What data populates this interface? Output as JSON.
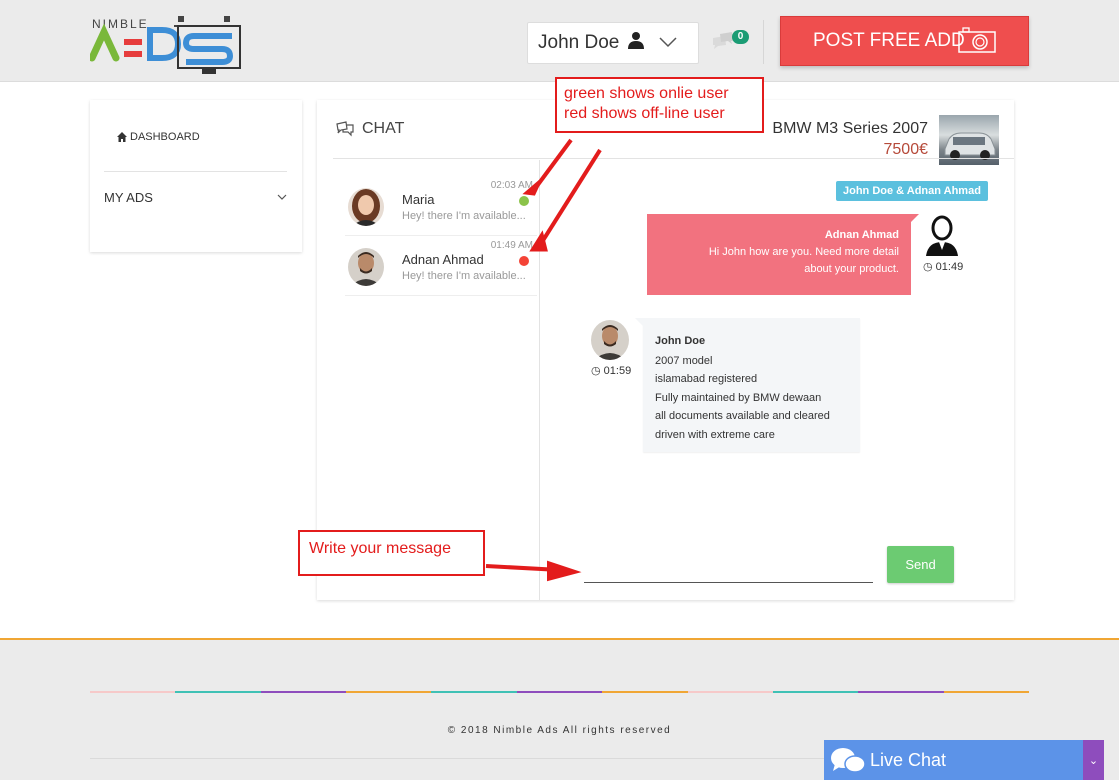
{
  "header": {
    "logo_top": "NIMBLE",
    "logo_main": "ADS",
    "user_name": "John Doe",
    "message_count": "0",
    "post_button_label": "POST FREE ADD"
  },
  "sidebar": {
    "dashboard_label": "DASHBOARD",
    "my_ads_label": "MY ADS"
  },
  "chat": {
    "title": "CHAT",
    "car_title": "BMW M3 Series 2007",
    "car_price": "7500€",
    "contacts": [
      {
        "name": "Maria",
        "preview": "Hey! there I'm available...",
        "time": "02:03 AM",
        "status": "online",
        "status_color": "#8bc34a"
      },
      {
        "name": "Adnan Ahmad",
        "preview": "Hey! there I'm available...",
        "time": "01:49 AM",
        "status": "offline",
        "status_color": "#f44336"
      }
    ],
    "conversation_badge": "John Doe & Adnan Ahmad",
    "messages": [
      {
        "sender": "Adnan Ahmad",
        "lines": [
          "Hi John how are you. Need more detail",
          "about your product."
        ],
        "time": "01:49"
      },
      {
        "sender": "John Doe",
        "lines": [
          "2007 model",
          "islamabad registered",
          "Fully maintained by BMW dewaan",
          "all documents available and cleared",
          "driven with extreme care"
        ],
        "time": "01:59"
      }
    ],
    "input_value": "",
    "input_placeholder": "",
    "send_label": "Send"
  },
  "annotations": {
    "status_note_line1": "green shows onlie user",
    "status_note_line2": "red shows off-line user",
    "input_note": "Write your message"
  },
  "footer": {
    "copyright": "© 2018 Nimble Ads All rights reserved"
  },
  "live_chat": {
    "label": "Live Chat"
  },
  "colors": {
    "accent_red": "#ef4e4e",
    "send_green": "#6ccb72",
    "incoming_bubble": "#f2727f",
    "badge_blue": "#5bc0de",
    "live_chat_blue": "#5c93e8",
    "footer_orange": "#f0a634"
  }
}
